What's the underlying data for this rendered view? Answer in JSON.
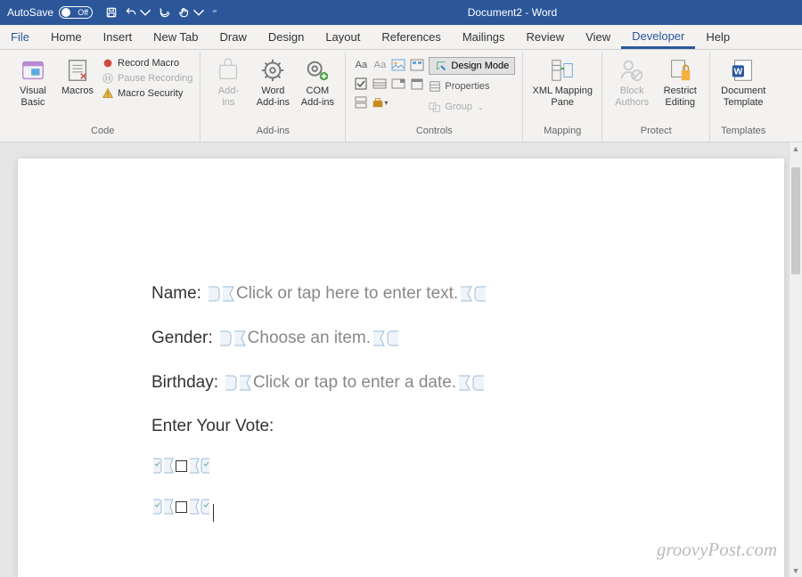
{
  "titlebar": {
    "autosave_label": "AutoSave",
    "autosave_state": "Off",
    "document_title": "Document2 - Word"
  },
  "tabs": [
    "File",
    "Home",
    "Insert",
    "New Tab",
    "Draw",
    "Design",
    "Layout",
    "References",
    "Mailings",
    "Review",
    "View",
    "Developer",
    "Help"
  ],
  "active_tab": "Developer",
  "ribbon": {
    "code": {
      "label": "Code",
      "visual_basic": "Visual\nBasic",
      "macros": "Macros",
      "record_macro": "Record Macro",
      "pause_recording": "Pause Recording",
      "macro_security": "Macro Security"
    },
    "addins": {
      "label": "Add-ins",
      "addins": "Add-\nins",
      "word_addins": "Word\nAdd-ins",
      "com_addins": "COM\nAdd-ins"
    },
    "controls": {
      "label": "Controls",
      "design_mode": "Design Mode",
      "properties": "Properties",
      "group": "Group"
    },
    "mapping": {
      "label": "Mapping",
      "xml_mapping": "XML Mapping\nPane"
    },
    "protect": {
      "label": "Protect",
      "block_authors": "Block\nAuthors",
      "restrict_editing": "Restrict\nEditing"
    },
    "templates": {
      "label": "Templates",
      "doc_template": "Document\nTemplate"
    }
  },
  "doc": {
    "name_label": "Name:",
    "name_placeholder": "Click or tap here to enter text.",
    "gender_label": "Gender:",
    "gender_placeholder": "Choose an item.",
    "birthday_label": "Birthday:",
    "birthday_placeholder": "Click or tap to enter a date.",
    "vote_label": "Enter Your Vote:"
  },
  "watermark": "groovyPost.com"
}
